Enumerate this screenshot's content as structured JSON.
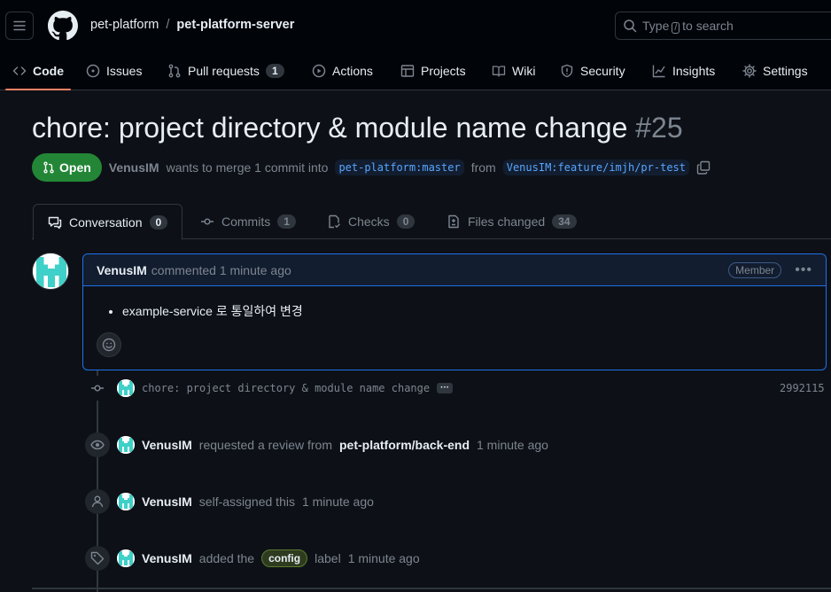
{
  "header": {
    "owner": "pet-platform",
    "separator": "/",
    "repo": "pet-platform-server",
    "search": {
      "prefix": "Type",
      "key": "/",
      "suffix": "to search"
    }
  },
  "repo_tabs": [
    {
      "label": "Code",
      "icon": "code-icon",
      "active": true
    },
    {
      "label": "Issues",
      "icon": "issue-icon"
    },
    {
      "label": "Pull requests",
      "icon": "pull-request-icon",
      "count": "1"
    },
    {
      "label": "Actions",
      "icon": "play-icon"
    },
    {
      "label": "Projects",
      "icon": "table-icon"
    },
    {
      "label": "Wiki",
      "icon": "book-icon"
    },
    {
      "label": "Security",
      "icon": "shield-icon"
    },
    {
      "label": "Insights",
      "icon": "graph-icon"
    },
    {
      "label": "Settings",
      "icon": "gear-icon"
    }
  ],
  "pr": {
    "title": "chore: project directory & module name change",
    "number": "#25",
    "state": "Open",
    "author": "VenusIM",
    "merge_text": "wants to merge 1 commit into",
    "base": "pet-platform:master",
    "from_text": "from",
    "head": "VenusIM:feature/imjh/pr-test"
  },
  "pr_tabs": [
    {
      "label": "Conversation",
      "count": "0",
      "icon": "comment-icon",
      "active": true
    },
    {
      "label": "Commits",
      "count": "1",
      "icon": "commit-icon"
    },
    {
      "label": "Checks",
      "count": "0",
      "icon": "checklist-icon"
    },
    {
      "label": "Files changed",
      "count": "34",
      "icon": "file-diff-icon"
    }
  ],
  "comment": {
    "author": "VenusIM",
    "when": "commented 1 minute ago",
    "role": "Member",
    "bullet": "example-service 로 통일하여 변경"
  },
  "timeline": {
    "commit": {
      "message": "chore: project directory & module name change",
      "sha": "2992115"
    },
    "review": {
      "actor": "VenusIM",
      "text": "requested a review from",
      "team": "pet-platform/back-end",
      "when": "1 minute ago"
    },
    "assign": {
      "actor": "VenusIM",
      "text": "self-assigned this",
      "when": "1 minute ago"
    },
    "label": {
      "actor": "VenusIM",
      "text": "added the",
      "label": "config",
      "suffix": "label",
      "when": "1 minute ago"
    }
  },
  "colors": {
    "accent": "#f78166",
    "open": "#238636",
    "link": "#58a6ff",
    "avatar": "#3fd0c9"
  }
}
